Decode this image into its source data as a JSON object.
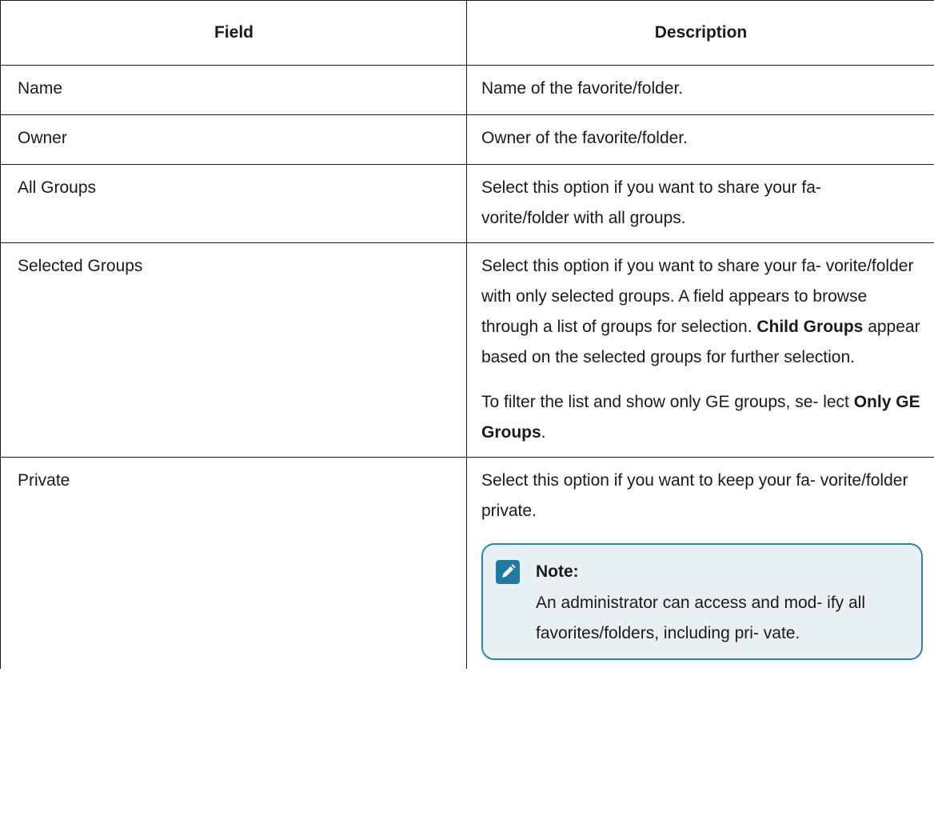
{
  "table": {
    "headers": [
      "Field",
      "Description"
    ],
    "rows": {
      "name": {
        "field": "Name",
        "description": "Name of the favorite/folder."
      },
      "owner": {
        "field": "Owner",
        "description": "Owner of the favorite/folder."
      },
      "all_groups": {
        "field": "All Groups",
        "description_line1": "Select this option if you want to share your fa-",
        "description_line2": "vorite/folder with all groups."
      },
      "selected_groups": {
        "field": "Selected Groups",
        "p1_text": "Select this option if you want to share your fa- vorite/folder with only selected groups. A field appears to browse through a list of groups for selection. ",
        "p1_bold": "Child Groups",
        "p1_tail": " appear based on the selected groups for further selection.",
        "p2_text": "To filter the list and show only GE groups, se- lect ",
        "p2_bold": "Only GE Groups",
        "p2_tail": "."
      },
      "private": {
        "field": "Private",
        "description": "Select this option if you want to keep your fa- vorite/folder private.",
        "note_title": "Note:",
        "note_body": "An administrator can access and mod- ify all favorites/folders, including pri- vate."
      }
    }
  },
  "colors": {
    "note_border": "#2d84a8",
    "note_background": "#e9f0f4",
    "note_icon": "#1f7aa3"
  },
  "icons": {
    "note": "pencil-icon"
  }
}
